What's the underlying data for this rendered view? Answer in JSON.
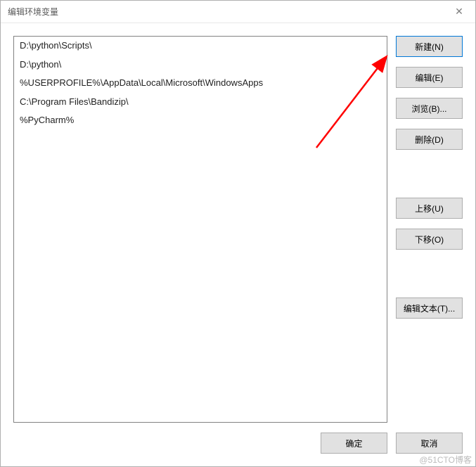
{
  "titlebar": {
    "title": "编辑环境变量",
    "close_glyph": "✕"
  },
  "list": {
    "items": [
      "D:\\python\\Scripts\\",
      "D:\\python\\",
      "%USERPROFILE%\\AppData\\Local\\Microsoft\\WindowsApps",
      "C:\\Program Files\\Bandizip\\",
      "%PyCharm%"
    ]
  },
  "buttons": {
    "new": "新建(N)",
    "edit": "编辑(E)",
    "browse": "浏览(B)...",
    "delete": "删除(D)",
    "move_up": "上移(U)",
    "move_down": "下移(O)",
    "edit_text": "编辑文本(T)...",
    "ok": "确定",
    "cancel": "取消"
  },
  "watermark": "@51CTO博客"
}
